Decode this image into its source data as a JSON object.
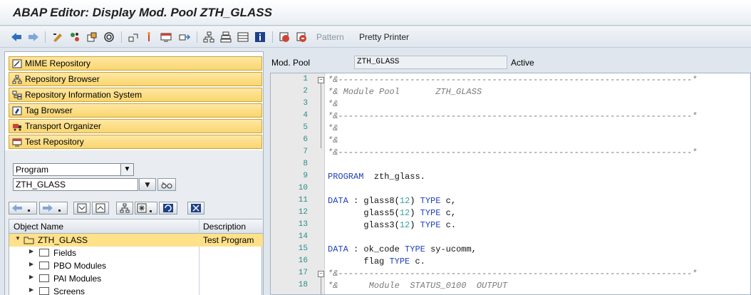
{
  "window": {
    "title": "ABAP Editor: Display Mod. Pool ZTH_GLASS"
  },
  "toolbar": {
    "pattern_label": "Pattern",
    "pretty_printer_label": "Pretty Printer"
  },
  "nav": {
    "items": [
      {
        "label": "MIME Repository",
        "icon": "mime-icon"
      },
      {
        "label": "Repository Browser",
        "icon": "repository-browser-icon"
      },
      {
        "label": "Repository Information System",
        "icon": "info-system-icon"
      },
      {
        "label": "Tag Browser",
        "icon": "tag-icon"
      },
      {
        "label": "Transport Organizer",
        "icon": "truck-icon"
      },
      {
        "label": "Test Repository",
        "icon": "test-icon"
      }
    ]
  },
  "object_selector": {
    "type_value": "Program",
    "name_value": "ZTH_GLASS"
  },
  "tree": {
    "col_object": "Object Name",
    "col_desc": "Description",
    "root": {
      "label": "ZTH_GLASS",
      "description": "Test Program"
    },
    "children": [
      "Fields",
      "PBO Modules",
      "PAI Modules",
      "Screens"
    ]
  },
  "header": {
    "type_label": "Mod. Pool",
    "program_name": "ZTH_GLASS",
    "status": "Active"
  },
  "code": {
    "lines": [
      {
        "n": "1",
        "text": "*&---------------------------------------------------------------------*",
        "cls": "cmt"
      },
      {
        "n": "2",
        "text": "*& Module Pool       ZTH_GLASS",
        "cls": "cmt"
      },
      {
        "n": "3",
        "text": "*&",
        "cls": "cmt"
      },
      {
        "n": "4",
        "text": "*&---------------------------------------------------------------------*",
        "cls": "cmt"
      },
      {
        "n": "5",
        "text": "*&",
        "cls": "cmt"
      },
      {
        "n": "6",
        "text": "*&",
        "cls": "cmt"
      },
      {
        "n": "7",
        "text": "*&---------------------------------------------------------------------*",
        "cls": "cmt"
      },
      {
        "n": "8",
        "text": "",
        "cls": "txt"
      },
      {
        "n": "9",
        "text": "PROGRAM  zth_glass.",
        "cls": "mixed9"
      },
      {
        "n": "10",
        "text": "",
        "cls": "txt"
      },
      {
        "n": "11",
        "text": "DATA : glass8(12) TYPE c,",
        "cls": "mixed11"
      },
      {
        "n": "12",
        "text": "       glass5(12) TYPE c,",
        "cls": "mixed12"
      },
      {
        "n": "13",
        "text": "       glass3(12) TYPE c.",
        "cls": "mixed13"
      },
      {
        "n": "14",
        "text": "",
        "cls": "txt"
      },
      {
        "n": "15",
        "text": "DATA : ok_code TYPE sy-ucomm,",
        "cls": "mixed15"
      },
      {
        "n": "16",
        "text": "       flag TYPE c.",
        "cls": "mixed16"
      },
      {
        "n": "17",
        "text": "*&---------------------------------------------------------------------*",
        "cls": "cmt"
      },
      {
        "n": "18",
        "text": "*&      Module  STATUS_0100  OUTPUT",
        "cls": "cmt"
      }
    ]
  }
}
